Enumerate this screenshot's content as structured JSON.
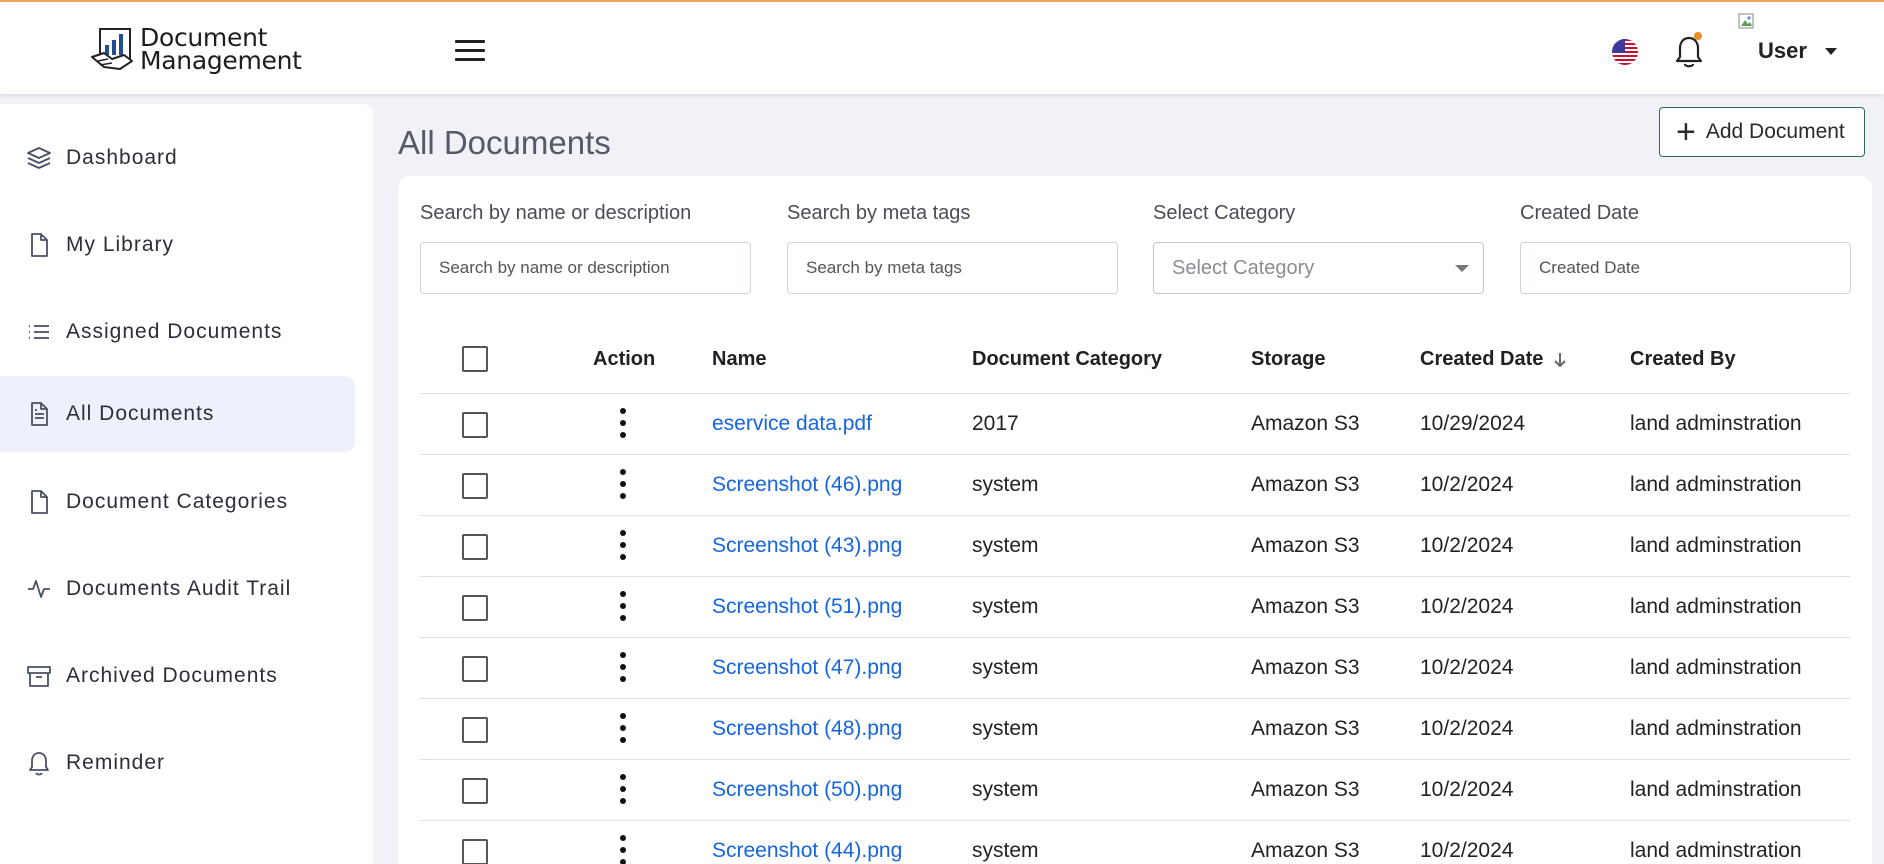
{
  "header": {
    "logo_line1": "Document",
    "logo_line2": "Management",
    "user_label": "User",
    "flag_icon": "us-flag-icon",
    "notification_icon": "bell-icon",
    "accent_color": "#f0a35a"
  },
  "sidebar": {
    "items": [
      {
        "label": "Dashboard",
        "icon": "layers-icon"
      },
      {
        "label": "My Library",
        "icon": "file-icon"
      },
      {
        "label": "Assigned Documents",
        "icon": "list-icon"
      },
      {
        "label": "All Documents",
        "icon": "file-text-icon",
        "active": true
      },
      {
        "label": "Document Categories",
        "icon": "file-icon"
      },
      {
        "label": "Documents Audit Trail",
        "icon": "activity-icon"
      },
      {
        "label": "Archived Documents",
        "icon": "archive-icon"
      },
      {
        "label": "Reminder",
        "icon": "bell-icon"
      }
    ]
  },
  "main": {
    "title": "All Documents",
    "add_button_label": "Add Document",
    "filters": {
      "name_label": "Search by name or description",
      "name_placeholder": "Search by name or description",
      "meta_label": "Search by meta tags",
      "meta_placeholder": "Search by meta tags",
      "category_label": "Select Category",
      "category_value": "Select Category",
      "date_label": "Created Date",
      "date_placeholder": "Created Date"
    },
    "table": {
      "columns": [
        "Action",
        "Name",
        "Document Category",
        "Storage",
        "Created Date",
        "Created By"
      ],
      "sort_column": "Created Date",
      "sort_direction": "descending",
      "rows": [
        {
          "name": "eservice data.pdf",
          "category": "2017",
          "storage": "Amazon S3",
          "date": "10/29/2024",
          "by": "land adminstration"
        },
        {
          "name": "Screenshot (46).png",
          "category": "system",
          "storage": "Amazon S3",
          "date": "10/2/2024",
          "by": "land adminstration"
        },
        {
          "name": "Screenshot (43).png",
          "category": "system",
          "storage": "Amazon S3",
          "date": "10/2/2024",
          "by": "land adminstration"
        },
        {
          "name": "Screenshot (51).png",
          "category": "system",
          "storage": "Amazon S3",
          "date": "10/2/2024",
          "by": "land adminstration"
        },
        {
          "name": "Screenshot (47).png",
          "category": "system",
          "storage": "Amazon S3",
          "date": "10/2/2024",
          "by": "land adminstration"
        },
        {
          "name": "Screenshot (48).png",
          "category": "system",
          "storage": "Amazon S3",
          "date": "10/2/2024",
          "by": "land adminstration"
        },
        {
          "name": "Screenshot (50).png",
          "category": "system",
          "storage": "Amazon S3",
          "date": "10/2/2024",
          "by": "land adminstration"
        },
        {
          "name": "Screenshot (44).png",
          "category": "system",
          "storage": "Amazon S3",
          "date": "10/2/2024",
          "by": "land adminstration"
        }
      ]
    }
  }
}
